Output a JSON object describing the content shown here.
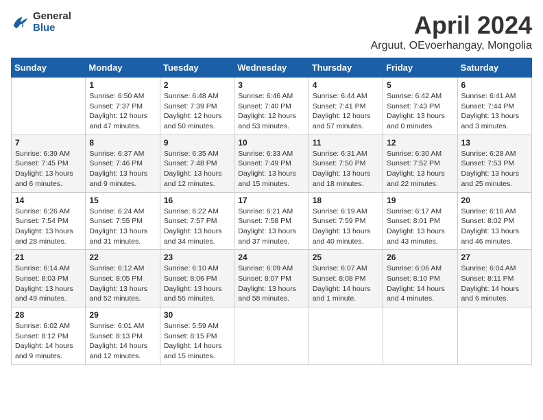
{
  "header": {
    "logo_general": "General",
    "logo_blue": "Blue",
    "title": "April 2024",
    "location": "Arguut, OEvoerhangay, Mongolia"
  },
  "weekdays": [
    "Sunday",
    "Monday",
    "Tuesday",
    "Wednesday",
    "Thursday",
    "Friday",
    "Saturday"
  ],
  "weeks": [
    [
      {
        "day": null
      },
      {
        "day": "1",
        "sunrise": "6:50 AM",
        "sunset": "7:37 PM",
        "daylight": "12 hours and 47 minutes."
      },
      {
        "day": "2",
        "sunrise": "6:48 AM",
        "sunset": "7:39 PM",
        "daylight": "12 hours and 50 minutes."
      },
      {
        "day": "3",
        "sunrise": "6:46 AM",
        "sunset": "7:40 PM",
        "daylight": "12 hours and 53 minutes."
      },
      {
        "day": "4",
        "sunrise": "6:44 AM",
        "sunset": "7:41 PM",
        "daylight": "12 hours and 57 minutes."
      },
      {
        "day": "5",
        "sunrise": "6:42 AM",
        "sunset": "7:43 PM",
        "daylight": "13 hours and 0 minutes."
      },
      {
        "day": "6",
        "sunrise": "6:41 AM",
        "sunset": "7:44 PM",
        "daylight": "13 hours and 3 minutes."
      }
    ],
    [
      {
        "day": "7",
        "sunrise": "6:39 AM",
        "sunset": "7:45 PM",
        "daylight": "13 hours and 6 minutes."
      },
      {
        "day": "8",
        "sunrise": "6:37 AM",
        "sunset": "7:46 PM",
        "daylight": "13 hours and 9 minutes."
      },
      {
        "day": "9",
        "sunrise": "6:35 AM",
        "sunset": "7:48 PM",
        "daylight": "13 hours and 12 minutes."
      },
      {
        "day": "10",
        "sunrise": "6:33 AM",
        "sunset": "7:49 PM",
        "daylight": "13 hours and 15 minutes."
      },
      {
        "day": "11",
        "sunrise": "6:31 AM",
        "sunset": "7:50 PM",
        "daylight": "13 hours and 18 minutes."
      },
      {
        "day": "12",
        "sunrise": "6:30 AM",
        "sunset": "7:52 PM",
        "daylight": "13 hours and 22 minutes."
      },
      {
        "day": "13",
        "sunrise": "6:28 AM",
        "sunset": "7:53 PM",
        "daylight": "13 hours and 25 minutes."
      }
    ],
    [
      {
        "day": "14",
        "sunrise": "6:26 AM",
        "sunset": "7:54 PM",
        "daylight": "13 hours and 28 minutes."
      },
      {
        "day": "15",
        "sunrise": "6:24 AM",
        "sunset": "7:55 PM",
        "daylight": "13 hours and 31 minutes."
      },
      {
        "day": "16",
        "sunrise": "6:22 AM",
        "sunset": "7:57 PM",
        "daylight": "13 hours and 34 minutes."
      },
      {
        "day": "17",
        "sunrise": "6:21 AM",
        "sunset": "7:58 PM",
        "daylight": "13 hours and 37 minutes."
      },
      {
        "day": "18",
        "sunrise": "6:19 AM",
        "sunset": "7:59 PM",
        "daylight": "13 hours and 40 minutes."
      },
      {
        "day": "19",
        "sunrise": "6:17 AM",
        "sunset": "8:01 PM",
        "daylight": "13 hours and 43 minutes."
      },
      {
        "day": "20",
        "sunrise": "6:16 AM",
        "sunset": "8:02 PM",
        "daylight": "13 hours and 46 minutes."
      }
    ],
    [
      {
        "day": "21",
        "sunrise": "6:14 AM",
        "sunset": "8:03 PM",
        "daylight": "13 hours and 49 minutes."
      },
      {
        "day": "22",
        "sunrise": "6:12 AM",
        "sunset": "8:05 PM",
        "daylight": "13 hours and 52 minutes."
      },
      {
        "day": "23",
        "sunrise": "6:10 AM",
        "sunset": "8:06 PM",
        "daylight": "13 hours and 55 minutes."
      },
      {
        "day": "24",
        "sunrise": "6:09 AM",
        "sunset": "8:07 PM",
        "daylight": "13 hours and 58 minutes."
      },
      {
        "day": "25",
        "sunrise": "6:07 AM",
        "sunset": "8:08 PM",
        "daylight": "14 hours and 1 minute."
      },
      {
        "day": "26",
        "sunrise": "6:06 AM",
        "sunset": "8:10 PM",
        "daylight": "14 hours and 4 minutes."
      },
      {
        "day": "27",
        "sunrise": "6:04 AM",
        "sunset": "8:11 PM",
        "daylight": "14 hours and 6 minutes."
      }
    ],
    [
      {
        "day": "28",
        "sunrise": "6:02 AM",
        "sunset": "8:12 PM",
        "daylight": "14 hours and 9 minutes."
      },
      {
        "day": "29",
        "sunrise": "6:01 AM",
        "sunset": "8:13 PM",
        "daylight": "14 hours and 12 minutes."
      },
      {
        "day": "30",
        "sunrise": "5:59 AM",
        "sunset": "8:15 PM",
        "daylight": "14 hours and 15 minutes."
      },
      {
        "day": null
      },
      {
        "day": null
      },
      {
        "day": null
      },
      {
        "day": null
      }
    ]
  ],
  "labels": {
    "sunrise": "Sunrise:",
    "sunset": "Sunset:",
    "daylight": "Daylight:"
  }
}
